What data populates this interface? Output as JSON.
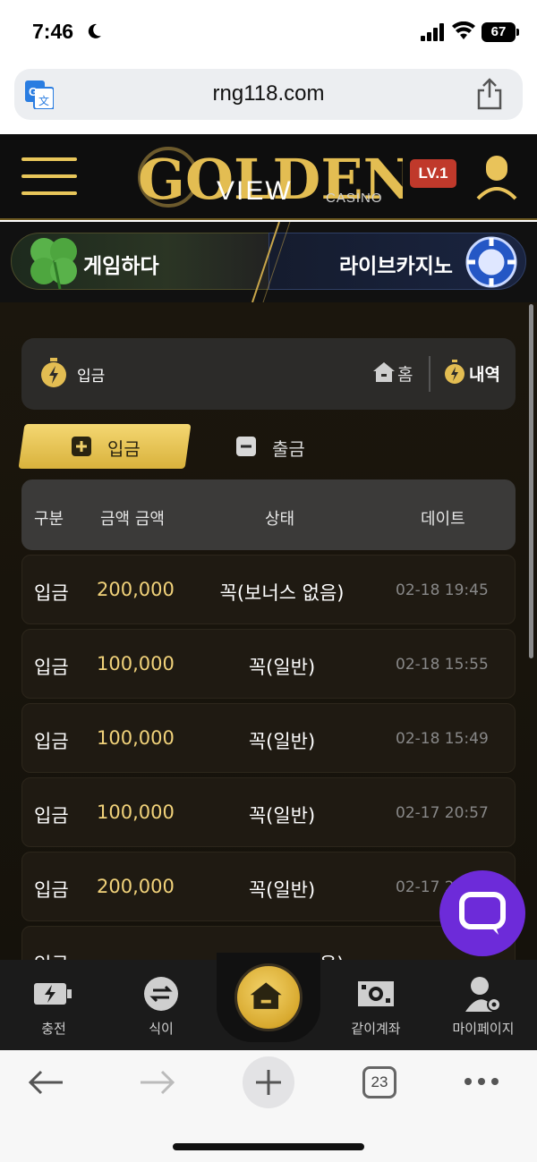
{
  "status_bar": {
    "time": "7:46",
    "battery": "67"
  },
  "browser": {
    "url": "rng118.com",
    "tab_count": "23"
  },
  "header": {
    "logo_line1": "GOLDEN",
    "logo_line2": "VIEW",
    "logo_line3": "CASINO",
    "level": "LV.1"
  },
  "banners": [
    {
      "label": "게임하다"
    },
    {
      "label": "라이브카지노"
    }
  ],
  "breadcrumb": {
    "title": "입금",
    "home_label": "홈",
    "history_label": "내역"
  },
  "tabs": [
    {
      "label": "입금",
      "active": true
    },
    {
      "label": "출금",
      "active": false
    }
  ],
  "table": {
    "headers": [
      "구분",
      "금액 금액",
      "상태",
      "데이트"
    ],
    "rows": [
      {
        "type": "입금",
        "amount": "200,000",
        "status": "꼭(보너스 없음)",
        "date": "02-18 19:45"
      },
      {
        "type": "입금",
        "amount": "100,000",
        "status": "꼭(일반)",
        "date": "02-18 15:55"
      },
      {
        "type": "입금",
        "amount": "100,000",
        "status": "꼭(일반)",
        "date": "02-18 15:49"
      },
      {
        "type": "입금",
        "amount": "100,000",
        "status": "꼭(일반)",
        "date": "02-17 20:57"
      },
      {
        "type": "입금",
        "amount": "200,000",
        "status": "꼭(일반)",
        "date": "02-17 2"
      },
      {
        "type": "입금",
        "amount": "",
        "status": "꼭(보너스 없음)",
        "date": ""
      }
    ]
  },
  "bottom_nav": [
    {
      "label": "충전",
      "icon": "battery-charge-icon"
    },
    {
      "label": "식이",
      "icon": "exchange-icon"
    },
    {
      "label": "",
      "icon": "home-icon"
    },
    {
      "label": "같이계좌",
      "icon": "cash-icon"
    },
    {
      "label": "마이페이지",
      "icon": "user-settings-icon"
    }
  ],
  "colors": {
    "gold": "#e8c65a",
    "amount": "#f1d27a",
    "chat": "#6d2bd9",
    "level_badge": "#c0392b"
  }
}
